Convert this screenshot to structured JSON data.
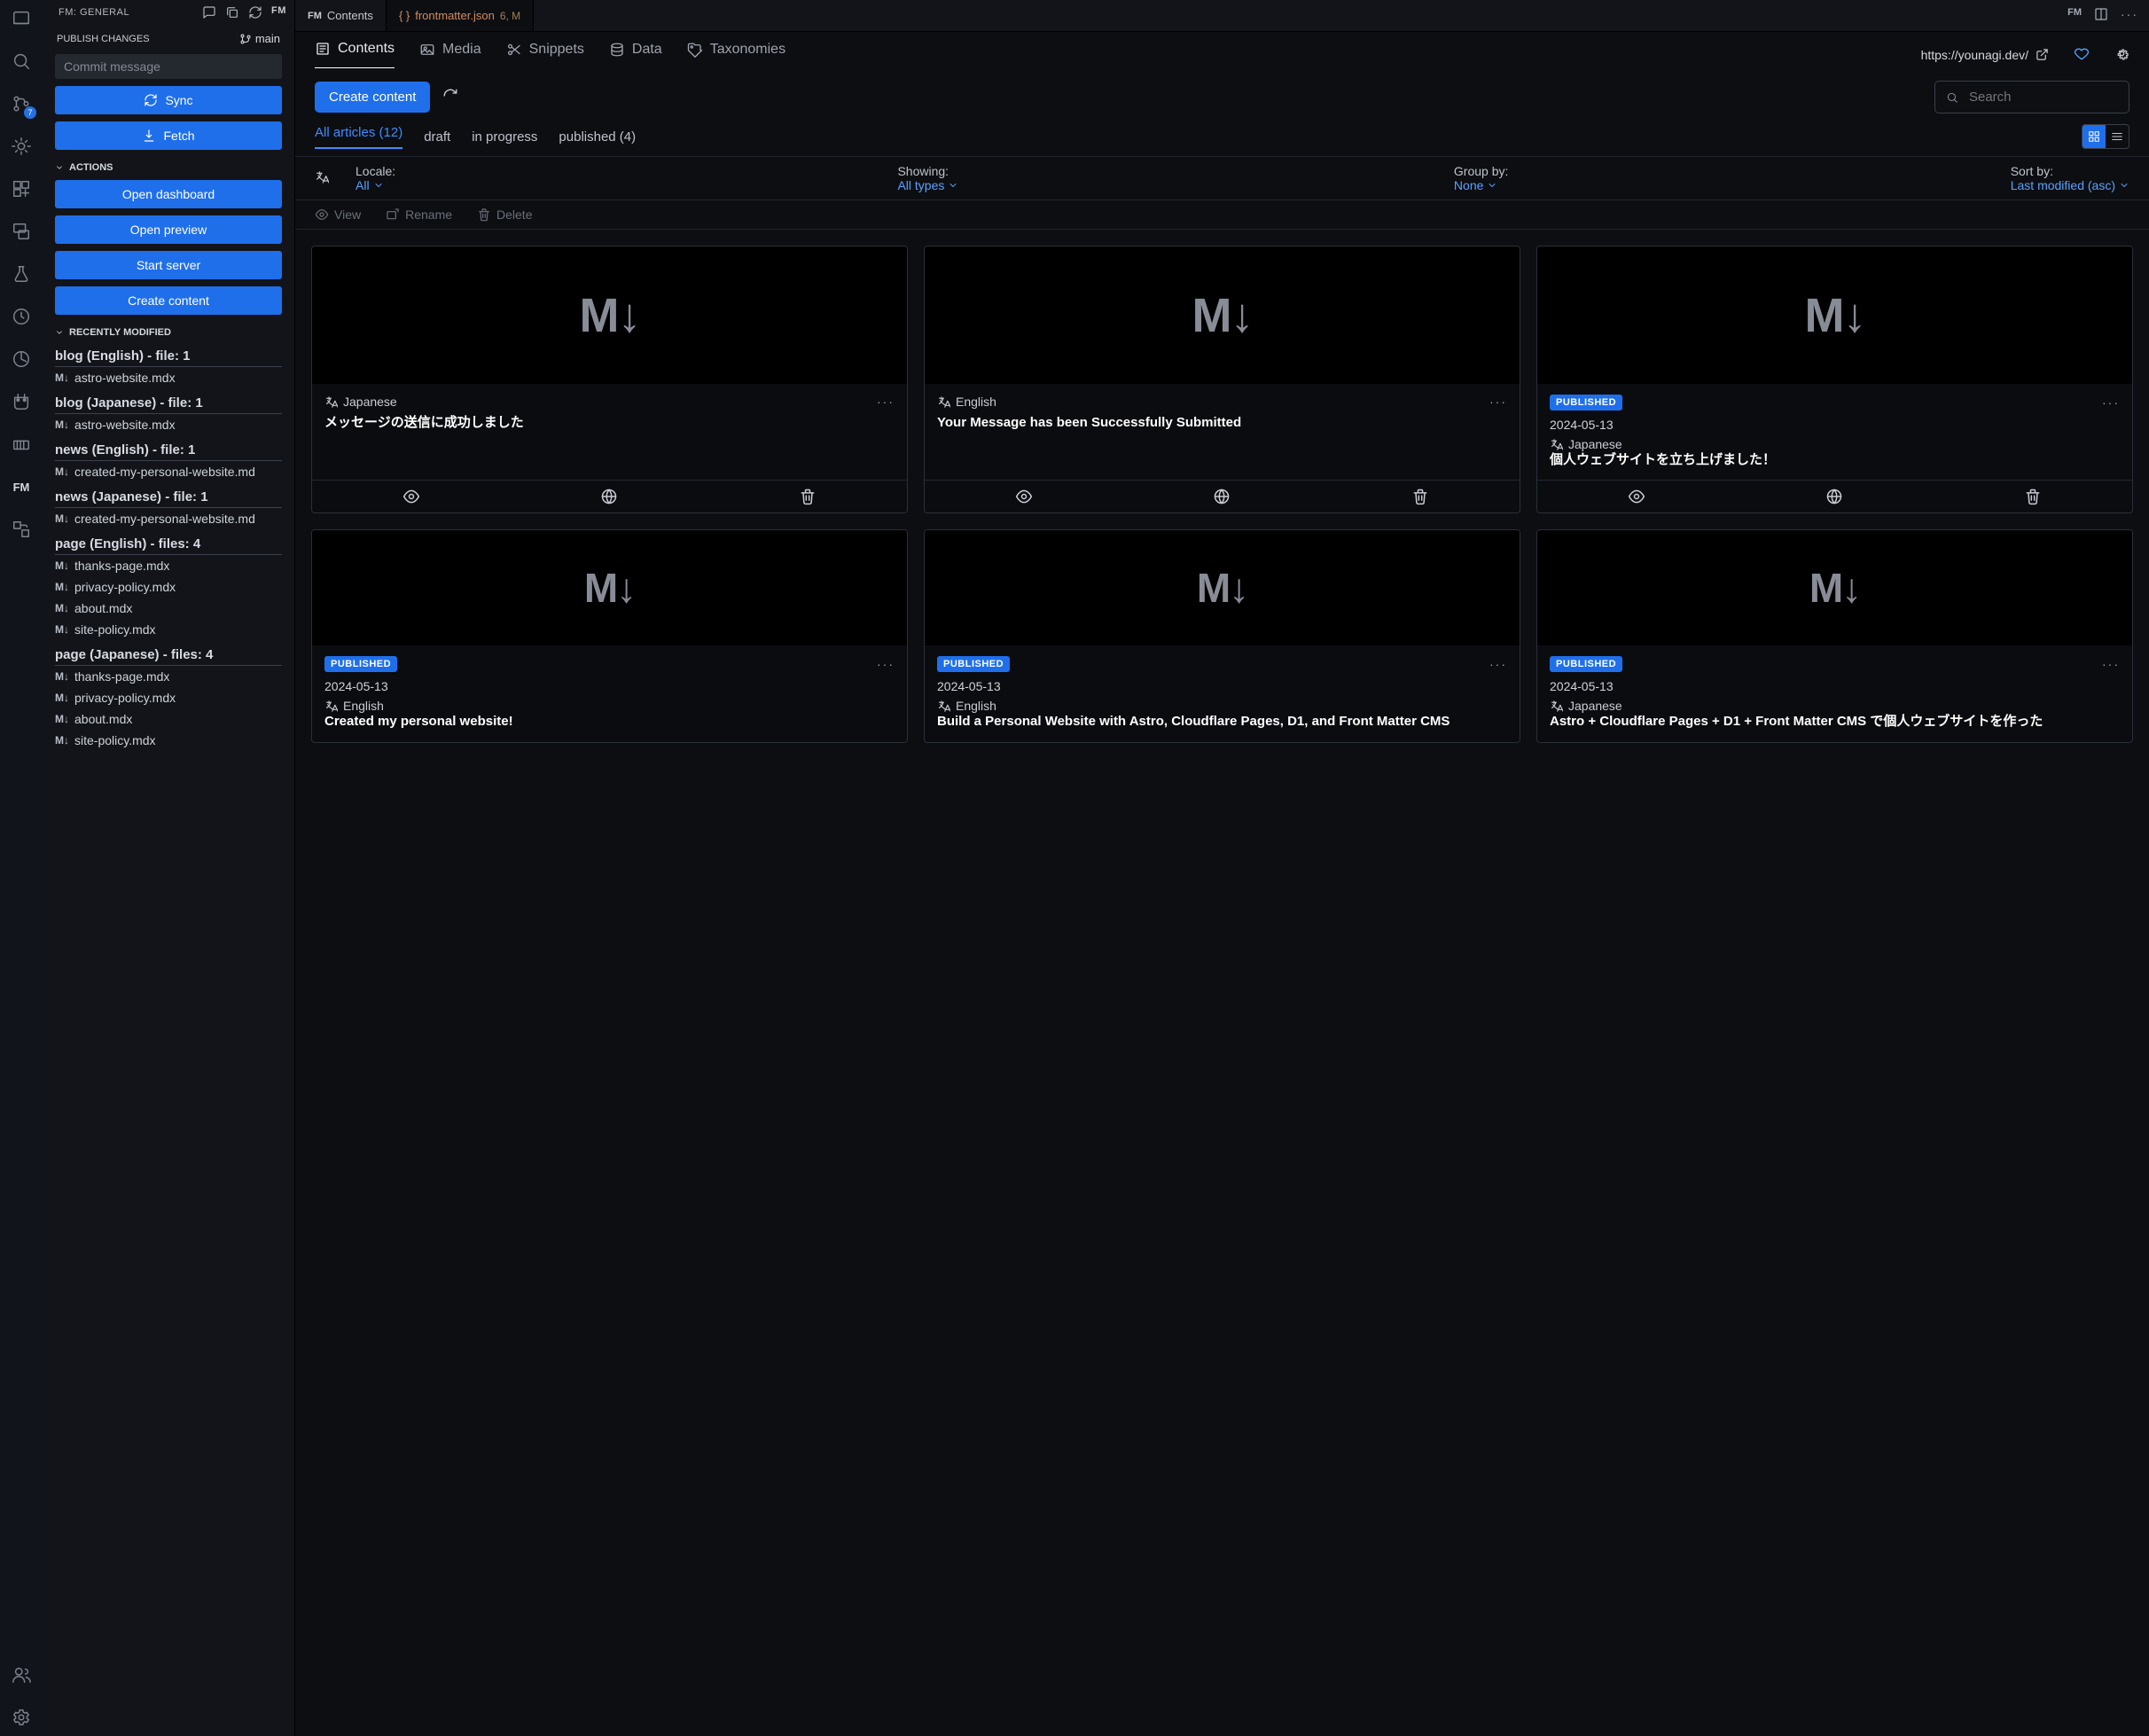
{
  "sidebar_header": "FM: GENERAL",
  "publish_section_label": "PUBLISH CHANGES",
  "branch": "main",
  "commit_placeholder": "Commit message",
  "btn_sync": "Sync",
  "btn_fetch": "Fetch",
  "actions_label": "ACTIONS",
  "btn_open_dashboard": "Open dashboard",
  "btn_open_preview": "Open preview",
  "btn_start_server": "Start server",
  "btn_create_content_side": "Create content",
  "recent_label": "RECENTLY MODIFIED",
  "recent_groups": [
    {
      "title": "blog (English) - file: 1",
      "files": [
        "astro-website.mdx"
      ]
    },
    {
      "title": "blog (Japanese) - file: 1",
      "files": [
        "astro-website.mdx"
      ]
    },
    {
      "title": "news (English) - file: 1",
      "files": [
        "created-my-personal-website.md"
      ]
    },
    {
      "title": "news (Japanese) - file: 1",
      "files": [
        "created-my-personal-website.md"
      ]
    },
    {
      "title": "page (English) - files: 4",
      "files": [
        "thanks-page.mdx",
        "privacy-policy.mdx",
        "about.mdx",
        "site-policy.mdx"
      ]
    },
    {
      "title": "page (Japanese) - files: 4",
      "files": [
        "thanks-page.mdx",
        "privacy-policy.mdx",
        "about.mdx",
        "site-policy.mdx"
      ]
    }
  ],
  "tab1": "Contents",
  "tab2_name": "frontmatter.json",
  "tab2_changes": "6, M",
  "nav": {
    "contents": "Contents",
    "media": "Media",
    "snippets": "Snippets",
    "data": "Data",
    "taxonomies": "Taxonomies"
  },
  "site_url": "https://younagi.dev/",
  "create_content": "Create content",
  "search_placeholder": "Search",
  "filters": {
    "all": "All articles (12)",
    "draft": "draft",
    "progress": "in progress",
    "published": "published (4)"
  },
  "locale_label": "Locale:",
  "locale_val": "All",
  "showing_label": "Showing:",
  "showing_val": "All types",
  "group_label": "Group by:",
  "group_val": "None",
  "sort_label": "Sort by:",
  "sort_val": "Last modified (asc)",
  "op_view": "View",
  "op_rename": "Rename",
  "op_delete": "Delete",
  "published_badge": "PUBLISHED",
  "cards": [
    {
      "lang": "Japanese",
      "title": "メッセージの送信に成功しました"
    },
    {
      "lang": "English",
      "title": "Your Message has been Successfully Submitted"
    },
    {
      "badge": true,
      "date": "2024-05-13",
      "lang": "Japanese",
      "title": "個人ウェブサイトを立ち上げました！"
    },
    {
      "badge": true,
      "date": "2024-05-13",
      "lang": "English",
      "title": "Created my personal website!"
    },
    {
      "badge": true,
      "date": "2024-05-13",
      "lang": "English",
      "title": "Build a Personal Website with Astro, Cloudflare Pages, D1, and Front Matter CMS"
    },
    {
      "badge": true,
      "date": "2024-05-13",
      "lang": "Japanese",
      "title": "Astro + Cloudflare Pages + D1 + Front Matter CMS で個人ウェブサイトを作った"
    }
  ]
}
